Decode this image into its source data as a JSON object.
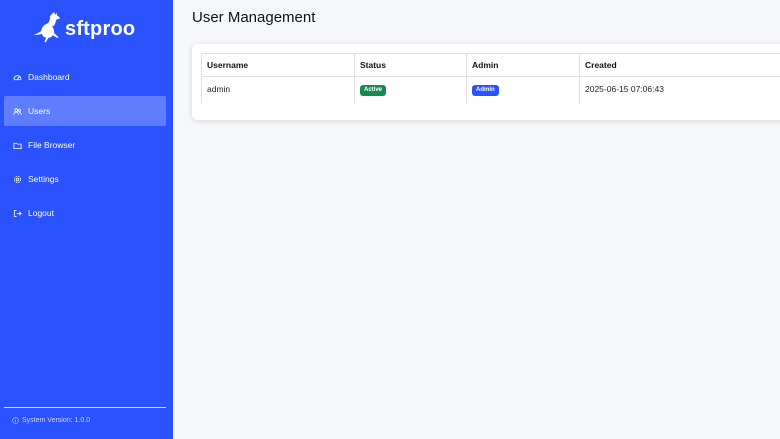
{
  "brand": {
    "name": "sftproo",
    "logo_icon": "kangaroo-icon"
  },
  "sidebar": {
    "items": [
      {
        "label": "Dashboard",
        "icon": "dashboard-icon",
        "active": false
      },
      {
        "label": "Users",
        "icon": "users-icon",
        "active": true
      },
      {
        "label": "File Browser",
        "icon": "folder-icon",
        "active": false
      },
      {
        "label": "Settings",
        "icon": "gear-icon",
        "active": false
      },
      {
        "label": "Logout",
        "icon": "logout-icon",
        "active": false
      }
    ],
    "version_label": "System Version: 1.0.0"
  },
  "page": {
    "title": "User Management"
  },
  "table": {
    "headers": [
      "Username",
      "Status",
      "Admin",
      "Created"
    ],
    "rows": [
      {
        "username": "admin",
        "status": "Active",
        "admin": "Admin",
        "created": "2025-06-15 07:06:43"
      }
    ]
  },
  "colors": {
    "primary": "#2b52ff",
    "success": "#198754",
    "background": "#f7f8fc"
  }
}
